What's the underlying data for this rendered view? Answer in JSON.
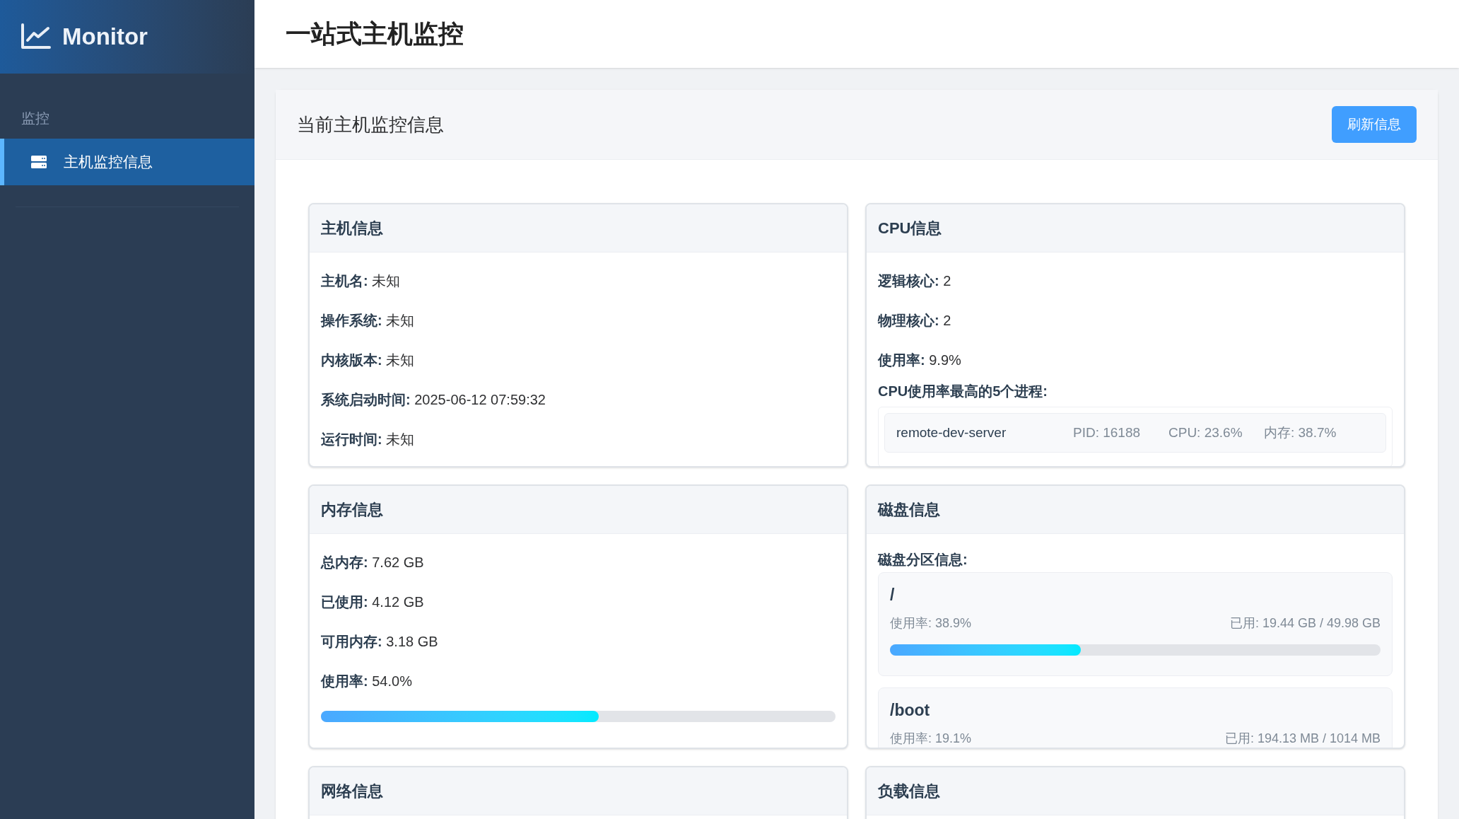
{
  "sidebar": {
    "logo": "Monitor",
    "section": "监控",
    "items": [
      {
        "label": "主机监控信息",
        "selected": true
      }
    ]
  },
  "header": {
    "title": "一站式主机监控"
  },
  "panel": {
    "title": "当前主机监控信息",
    "refresh_button": "刷新信息"
  },
  "cards": [
    {
      "kind": "fields",
      "title": "主机信息",
      "fields": [
        {
          "label": "主机名:",
          "value": "未知"
        },
        {
          "label": "操作系统:",
          "value": "未知"
        },
        {
          "label": "内核版本:",
          "value": "未知"
        },
        {
          "label": "系统启动时间:",
          "value": "2025-06-12 07:59:32"
        },
        {
          "label": "运行时间:",
          "value": "未知"
        }
      ]
    },
    {
      "kind": "cpu",
      "title": "CPU信息",
      "fields": [
        {
          "label": "逻辑核心:",
          "value": "2"
        },
        {
          "label": "物理核心:",
          "value": "2"
        },
        {
          "label": "使用率:",
          "value": "9.9%"
        }
      ],
      "processes_title": "CPU使用率最高的5个进程:",
      "processes": [
        {
          "name": "remote-dev-server",
          "pid": "PID: 16188",
          "cpu": "CPU: 23.6%",
          "memory": "内存: 38.7%"
        }
      ]
    },
    {
      "kind": "memory",
      "title": "内存信息",
      "fields": [
        {
          "label": "总内存:",
          "value": "7.62 GB"
        },
        {
          "label": "已使用:",
          "value": "4.12 GB"
        },
        {
          "label": "可用内存:",
          "value": "3.18 GB"
        },
        {
          "label": "使用率:",
          "value": "54.0%"
        }
      ],
      "level": 0.54
    },
    {
      "kind": "disk",
      "title": "磁盘信息",
      "partitions_title": "磁盘分区信息:",
      "partitions": [
        {
          "mount": "/",
          "usage": "使用率: 38.9%",
          "used": "已用: 19.44 GB / 49.98 GB",
          "level": 0.389
        },
        {
          "mount": "/boot",
          "usage": "使用率: 19.1%",
          "used": "已用: 194.13 MB / 1014 MB"
        }
      ]
    },
    {
      "kind": "fields",
      "title": "网络信息"
    },
    {
      "kind": "fields",
      "title": "负载信息"
    }
  ]
}
